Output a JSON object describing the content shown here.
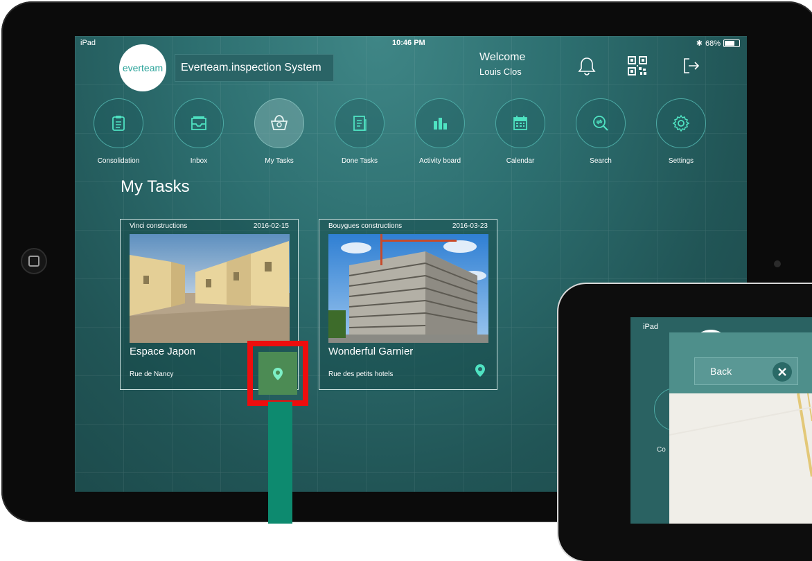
{
  "status_bar": {
    "device": "iPad",
    "time": "10:46 PM",
    "battery": "68%"
  },
  "header": {
    "logo_text": "everteam",
    "app_name": "Everteam.inspection System",
    "welcome": "Welcome",
    "user_name": "Louis Clos"
  },
  "header_icons": [
    "bell-icon",
    "qr-code-icon",
    "logout-icon"
  ],
  "nav": [
    {
      "label": "Consolidation",
      "icon": "clipboard-icon",
      "active": false
    },
    {
      "label": "Inbox",
      "icon": "inbox-tray-icon",
      "active": false
    },
    {
      "label": "My Tasks",
      "icon": "basket-icon",
      "active": true
    },
    {
      "label": "Done Tasks",
      "icon": "document-icon",
      "active": false
    },
    {
      "label": "Activity board",
      "icon": "bar-chart-icon",
      "active": false
    },
    {
      "label": "Calendar",
      "icon": "calendar-icon",
      "active": false
    },
    {
      "label": "Search",
      "icon": "search-icon",
      "active": false
    },
    {
      "label": "Settings",
      "icon": "gear-icon",
      "active": false
    }
  ],
  "section_title": "My Tasks",
  "tasks": [
    {
      "company": "Vinci constructions",
      "date": "2016-02-15",
      "title": "Espace Japon",
      "address": "Rue de Nancy"
    },
    {
      "company": "Bouygues constructions",
      "date": "2016-03-23",
      "title": "Wonderful Garnier",
      "address": "Rue des petits hotels"
    }
  ],
  "second_device": {
    "device": "iPad",
    "back_label": "Back",
    "partial_label": "Co"
  },
  "colors": {
    "accent": "#2aa39a",
    "highlight": "#ee0d0d",
    "arrow": "#0d8a6f",
    "pin": "#4fe3c2"
  }
}
